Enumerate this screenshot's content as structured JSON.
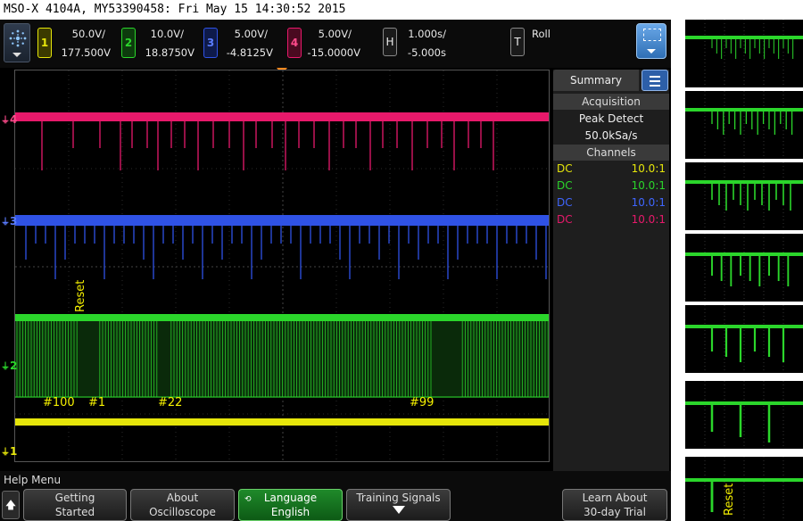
{
  "title_bar": "MSO-X 4104A, MY53390458: Fri May 15 14:30:52 2015",
  "channels": [
    {
      "num": "1",
      "scale": "50.0V/",
      "offset": "177.500V",
      "color": "#e6e60a"
    },
    {
      "num": "2",
      "scale": "10.0V/",
      "offset": "18.8750V",
      "color": "#2bd62b"
    },
    {
      "num": "3",
      "scale": "5.00V/",
      "offset": "-4.8125V",
      "color": "#2f52e6"
    },
    {
      "num": "4",
      "scale": "5.00V/",
      "offset": "-15.0000V",
      "color": "#e8196b"
    }
  ],
  "horizontal": {
    "key": "H",
    "scale": "1.000s/",
    "delay": "-5.000s"
  },
  "trigger": {
    "key": "T",
    "mode": "Roll"
  },
  "trace_markers": {
    "ch4": "4",
    "ch3": "3",
    "ch2": "2",
    "ch1": "1"
  },
  "annotations": {
    "reset": "Reset",
    "n100": "#100",
    "n1": "#1",
    "n22": "#22",
    "n99": "#99"
  },
  "sidebar": {
    "tab": "Summary",
    "acquisition_header": "Acquisition",
    "acq_mode": "Peak Detect",
    "sample_rate": "50.0kSa/s",
    "channels_header": "Channels",
    "rows": [
      {
        "coupling": "DC",
        "probe": "10.0:1"
      },
      {
        "coupling": "DC",
        "probe": "10.0:1"
      },
      {
        "coupling": "DC",
        "probe": "10.0:1"
      },
      {
        "coupling": "DC",
        "probe": "10.0:1"
      }
    ]
  },
  "softkeys": {
    "menu_title": "Help Menu",
    "getting_started": [
      "Getting",
      "Started"
    ],
    "about": [
      "About",
      "Oscilloscope"
    ],
    "language": [
      "Language",
      "English"
    ],
    "training": [
      "Training Signals"
    ],
    "learn": [
      "Learn About",
      "30-day Trial"
    ]
  },
  "thumbnail_label": "Reset",
  "colors": {
    "accent_blue": "#2f6fb5",
    "active_softkey": "#1f8a2a"
  }
}
